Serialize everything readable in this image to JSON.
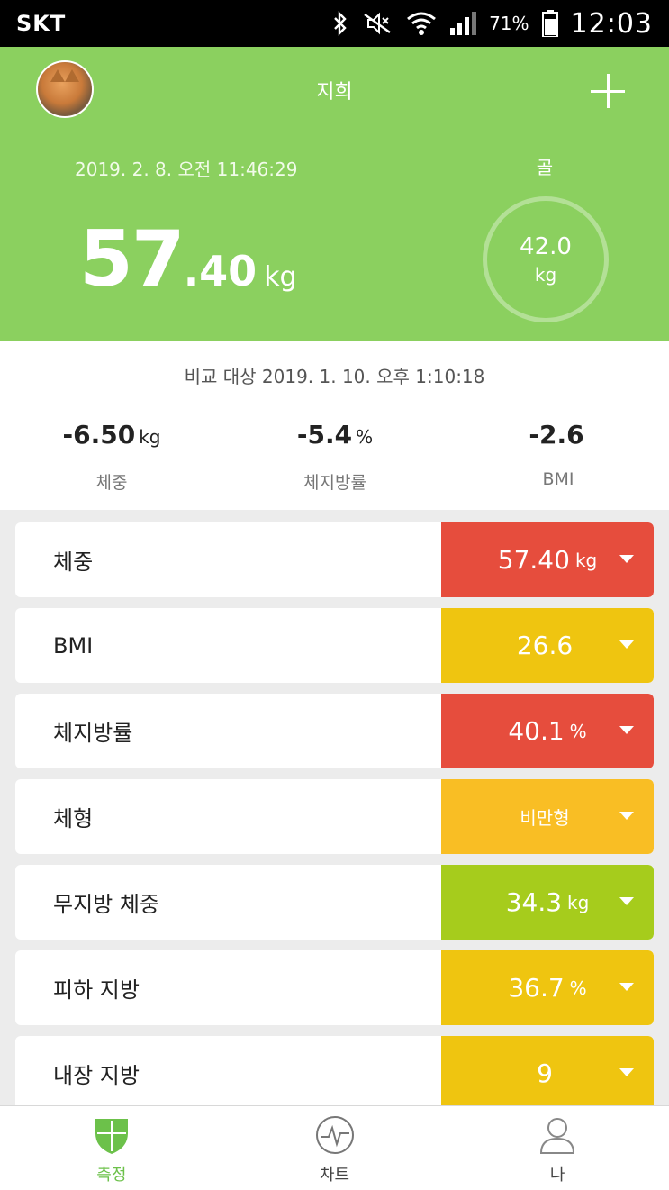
{
  "status_bar": {
    "carrier": "SKT",
    "battery": "71%",
    "time": "12:03"
  },
  "header": {
    "user_name": "지희",
    "measure_time": "2019. 2. 8. 오전 11:46:29",
    "weight_int": "57",
    "weight_dec": ".40",
    "weight_unit": "kg",
    "goal_label": "골",
    "goal_value": "42.0",
    "goal_unit": "kg"
  },
  "compare": {
    "title": "비교 대상 2019. 1. 10. 오후 1:10:18",
    "columns": [
      {
        "value": "-6.50",
        "unit": "kg",
        "label": "체중"
      },
      {
        "value": "-5.4",
        "unit": "%",
        "label": "체지방률"
      },
      {
        "value": "-2.6",
        "unit": "",
        "label": "BMI"
      }
    ]
  },
  "metrics": [
    {
      "label": "체중",
      "value": "57.40",
      "unit": "kg",
      "color": "#e64d3d"
    },
    {
      "label": "BMI",
      "value": "26.6",
      "unit": "",
      "color": "#efc510"
    },
    {
      "label": "체지방률",
      "value": "40.1",
      "unit": "%",
      "color": "#e64d3d"
    },
    {
      "label": "체형",
      "value": "비만형",
      "unit": "",
      "color": "#f9be24"
    },
    {
      "label": "무지방 체중",
      "value": "34.3",
      "unit": "kg",
      "color": "#a6cc1c"
    },
    {
      "label": "피하 지방",
      "value": "36.7",
      "unit": "%",
      "color": "#efc510"
    },
    {
      "label": "내장 지방",
      "value": "9",
      "unit": "",
      "color": "#efc510"
    }
  ],
  "nav": {
    "measure": "측정",
    "chart": "차트",
    "me": "나"
  },
  "colors": {
    "header_green": "#8bd05f",
    "active_green": "#6cc14a"
  }
}
